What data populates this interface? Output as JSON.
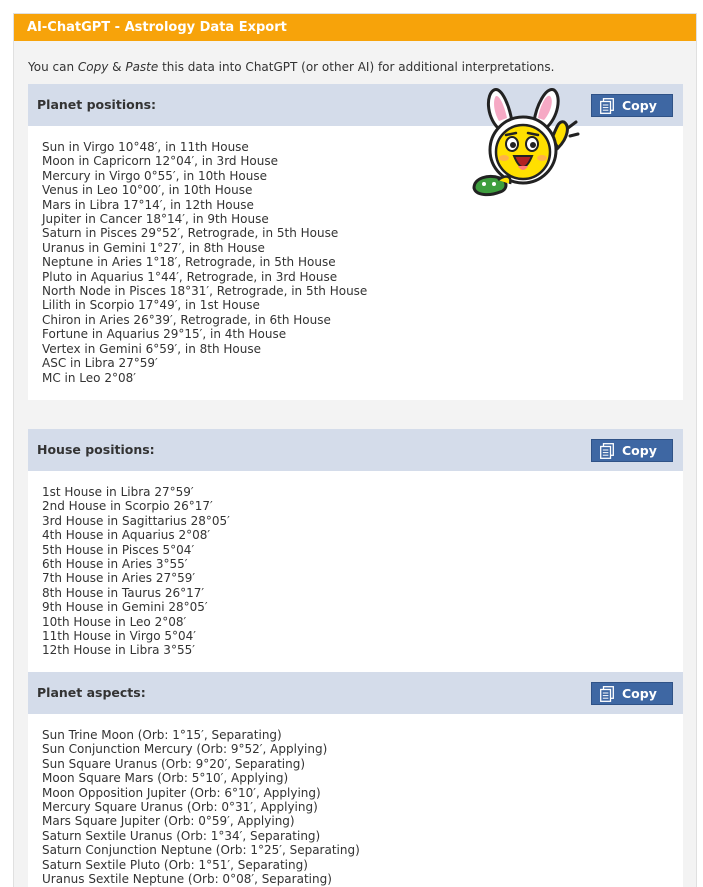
{
  "header": {
    "title": "AI-ChatGPT - Astrology Data Export"
  },
  "intro": {
    "prefix": "You can ",
    "copy_word": "Copy",
    "amp": " & ",
    "paste_word": "Paste",
    "suffix": " this data into ChatGPT (or other AI) for additional interpretations."
  },
  "copy_label": "Copy",
  "sections": [
    {
      "title": "Planet positions:",
      "lines": [
        "Sun in Virgo 10°48′, in 11th House",
        "Moon in Capricorn 12°04′, in 3rd House",
        "Mercury in Virgo 0°55′, in 10th House",
        "Venus in Leo 10°00′, in 10th House",
        "Mars in Libra 17°14′, in 12th House",
        "Jupiter in Cancer 18°14′, in 9th House",
        "Saturn in Pisces 29°52′, Retrograde, in 5th House",
        "Uranus in Gemini 1°27′, in 8th House",
        "Neptune in Aries 1°18′, Retrograde, in 5th House",
        "Pluto in Aquarius 1°44′, Retrograde, in 3rd House",
        "North Node in Pisces 18°31′, Retrograde, in 5th House",
        "Lilith in Scorpio 17°49′, in 1st House",
        "Chiron in Aries 26°39′, Retrograde, in 6th House",
        "Fortune in Aquarius 29°15′, in 4th House",
        "Vertex in Gemini 6°59′, in 8th House",
        "ASC in Libra 27°59′",
        "MC in Leo 2°08′"
      ]
    },
    {
      "title": "House positions:",
      "lines": [
        "1st House in Libra 27°59′",
        "2nd House in Scorpio 26°17′",
        "3rd House in Sagittarius 28°05′",
        "4th House in Aquarius 2°08′",
        "5th House in Pisces 5°04′",
        "6th House in Aries 3°55′",
        "7th House in Aries 27°59′",
        "8th House in Taurus 26°17′",
        "9th House in Gemini 28°05′",
        "10th House in Leo 2°08′",
        "11th House in Virgo 5°04′",
        "12th House in Libra 3°55′"
      ]
    },
    {
      "title": "Planet aspects:",
      "lines": [
        "Sun Trine Moon (Orb: 1°15′, Separating)",
        "Sun Conjunction Mercury (Orb: 9°52′, Applying)",
        "Sun Square Uranus (Orb: 9°20′, Separating)",
        "Moon Square Mars (Orb: 5°10′, Applying)",
        "Moon Opposition Jupiter (Orb: 6°10′, Applying)",
        "Mercury Square Uranus (Orb: 0°31′, Applying)",
        "Mars Square Jupiter (Orb: 0°59′, Applying)",
        "Saturn Sextile Uranus (Orb: 1°34′, Separating)",
        "Saturn Conjunction Neptune (Orb: 1°25′, Separating)",
        "Saturn Sextile Pluto (Orb: 1°51′, Separating)",
        "Uranus Sextile Neptune (Orb: 0°08′, Separating)"
      ]
    }
  ],
  "colors": {
    "title_bar": "#f7a30a",
    "section_header": "#d4dcea",
    "copy_button": "#3e67a3",
    "panel_bg": "#f3f3f3"
  },
  "icons": {
    "copy": "copy-clipboard-icon",
    "mascot": "bunny-mascot-icon"
  }
}
